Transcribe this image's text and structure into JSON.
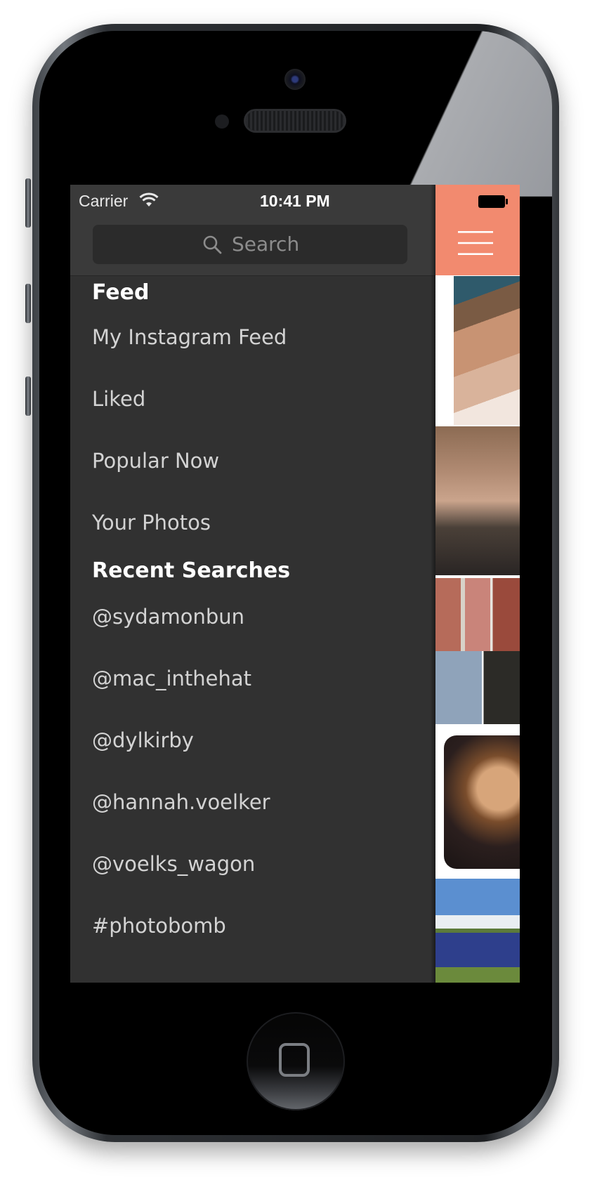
{
  "status_bar": {
    "carrier": "Carrier",
    "time": "10:41 PM"
  },
  "search": {
    "placeholder": "Search"
  },
  "sidebar": {
    "feed_title": "Feed",
    "feed_items": [
      {
        "label": "My Instagram Feed"
      },
      {
        "label": "Liked"
      },
      {
        "label": "Popular Now"
      },
      {
        "label": "Your Photos"
      }
    ],
    "recent_title": "Recent Searches",
    "recent_items": [
      {
        "label": "@sydamonbun"
      },
      {
        "label": "@mac_inthehat"
      },
      {
        "label": "@dylkirby"
      },
      {
        "label": "@hannah.voelker"
      },
      {
        "label": "@voelks_wagon"
      },
      {
        "label": "#photobomb"
      }
    ]
  },
  "icons": {
    "search": "search-icon",
    "wifi": "wifi-icon",
    "battery": "battery-icon",
    "menu": "hamburger-menu-icon"
  },
  "colors": {
    "sidebar_bg": "#313131",
    "search_bar_bg": "#3a3a3a",
    "nav_accent": "#f28a6f",
    "item_text": "#d3d3d3",
    "section_text": "#ffffff"
  }
}
